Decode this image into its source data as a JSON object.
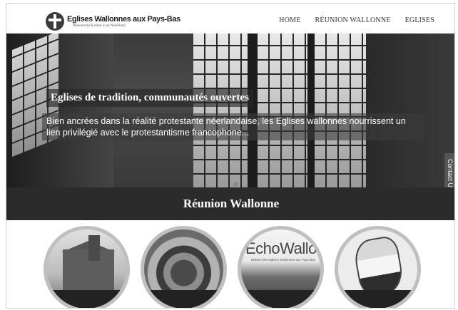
{
  "header": {
    "logo_title": "Eglises Wallonnes aux Pays-Bas",
    "logo_subtitle": "Wallonische Kerken in de Nederland"
  },
  "nav": {
    "items": [
      {
        "label": "HOME"
      },
      {
        "label": "RÉUNION WALLONNE"
      },
      {
        "label": "EGLISES"
      }
    ]
  },
  "hero": {
    "title": "Eglises de tradition, communautés ouvertes",
    "text": "Bien ancrées dans la réalité protestante néerlandaise, les Eglises wallonnes nourrissent un lien privilégié avec le protestantisme francophone..."
  },
  "contact_tab": {
    "label": "Contact Us",
    "icon": "chat-icon"
  },
  "section": {
    "title": "Réunion Wallonne"
  },
  "thumbnails": [
    {
      "name": "church-photo",
      "caption": ""
    },
    {
      "name": "stained-glass-rosette",
      "caption": ""
    },
    {
      "name": "echo-wallon",
      "title": "EchoWallon",
      "subtitle": "Bulletin des Eglises Wallonnes aux Pays-Bas"
    },
    {
      "name": "netherlands-map",
      "caption": ""
    }
  ],
  "colors": {
    "band": "#2b2b2b",
    "thumb_border": "#bfbfbf"
  }
}
